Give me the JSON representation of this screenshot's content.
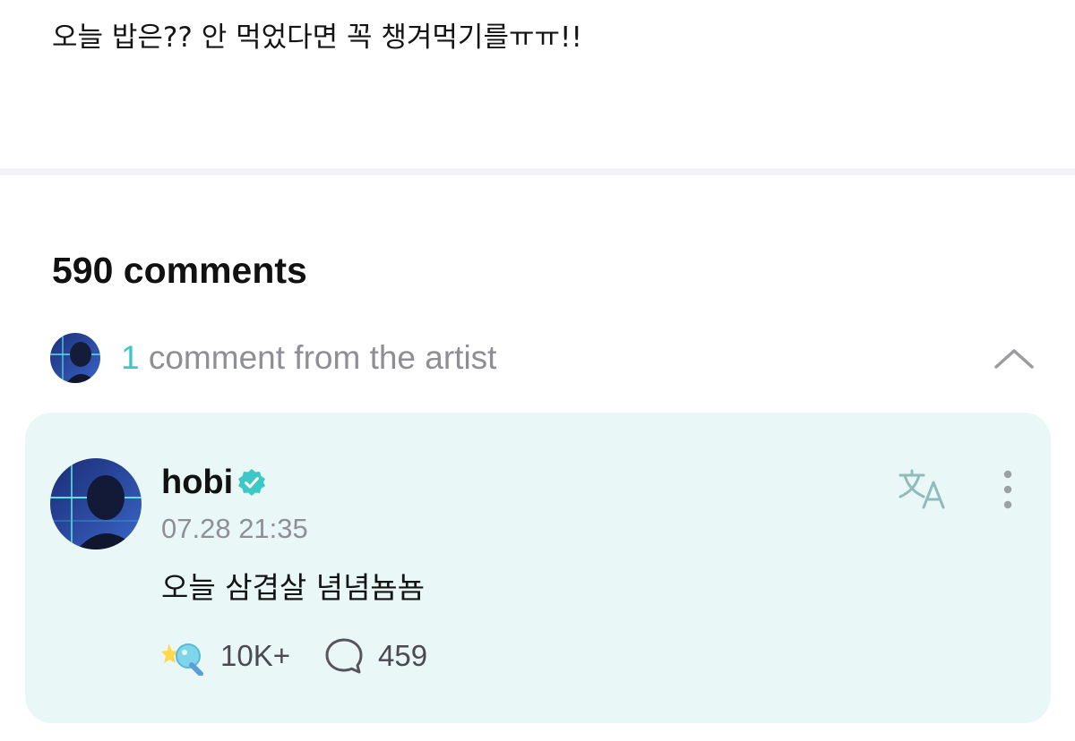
{
  "post": {
    "text": "오늘 밥은?? 안 먹었다면 꼭 챙겨먹기를ㅠㅠ!!"
  },
  "comments": {
    "count_label": "590 comments"
  },
  "artist_comments": {
    "count": "1",
    "label": " comment from the artist",
    "expand_icon": "chevron-up-icon"
  },
  "comment": {
    "author": "hobi",
    "verified_icon": "verified-badge-icon",
    "timestamp": "07.28 21:35",
    "text": "오늘 삼겹살 념념뇸뇸",
    "likes": "10K+",
    "replies": "459",
    "translate_icon": "translate-icon",
    "more_icon": "more-vertical-icon",
    "like_icon": "like-sticker-icon",
    "reply_icon": "speech-bubble-icon"
  },
  "colors": {
    "accent": "#3cc8c5",
    "card_bg": "#e9f8f7",
    "muted_text": "#8e8e95"
  }
}
